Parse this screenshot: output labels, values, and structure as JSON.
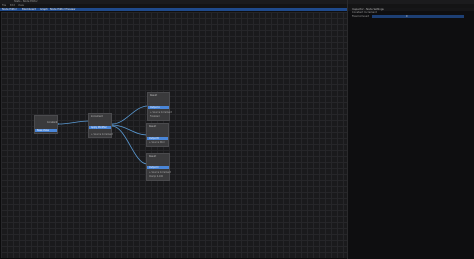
{
  "window": {
    "title": "Stats - Node Editor"
  },
  "menu": {
    "items": [
      "File",
      "Edit",
      "View"
    ]
  },
  "tabs": {
    "items": [
      "Node Editor",
      "Blackboard",
      "Graph",
      "Node Editor Preview"
    ]
  },
  "inspector": {
    "title": "Inspector - Node Settings",
    "lines": [
      "Constant Increment",
      "Fixed Amount"
    ],
    "field_value": "0"
  },
  "nodes": {
    "source": {
      "title": "Constant",
      "bar": "Base Value"
    },
    "hub": {
      "title": "Increment",
      "bar": "Apply Modifier",
      "sub": "+ Source Increment"
    },
    "out1": {
      "title": "Result",
      "bar": "Output A",
      "sub1": "+ Source Increment",
      "sub2": "Finalized"
    },
    "out2": {
      "title": "Result",
      "bar": "Output B",
      "sub": "+ Source Mod"
    },
    "out3": {
      "title": "Result",
      "bar": "Output C",
      "sub1": "+ Source Increment",
      "sub2": "Clamp 0-100"
    }
  },
  "colors": {
    "accent": "#4a86d8",
    "wire": "#5b9bd5",
    "canvas": "#1a1a1c"
  }
}
